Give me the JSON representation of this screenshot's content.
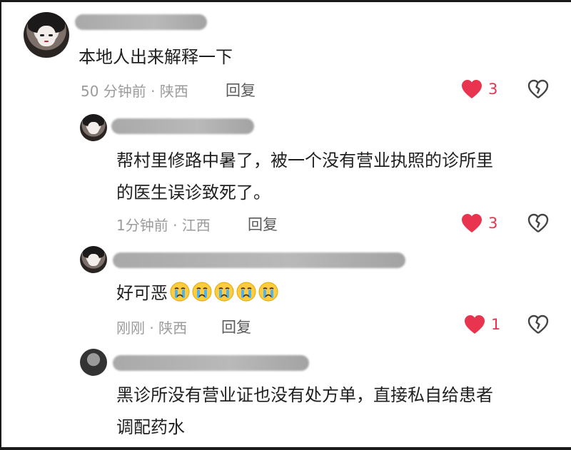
{
  "comments": [
    {
      "text": "本地人出来解释一下",
      "meta": "50 分钟前 · 陕西",
      "reply_label": "回复",
      "likes": "3"
    },
    {
      "text_line1": "帮村里修路中暑了，被一个没有营业执照的诊所里",
      "text_line2": "的医生误诊致死了。",
      "meta": "1分钟前 · 江西",
      "reply_label": "回复",
      "likes": "3"
    },
    {
      "text": "好可恶",
      "emoji": [
        "crying-face",
        "crying-face",
        "crying-face",
        "crying-face",
        "crying-face"
      ],
      "meta": "刚刚 · 陕西",
      "reply_label": "回复",
      "likes": "1"
    },
    {
      "text_line1": "黑诊所没有营业证也没有处方单，直接私自给患者",
      "text_line2": "调配药水"
    }
  ],
  "colors": {
    "like_red": "#e8344e",
    "meta_gray": "#9b9b9b"
  }
}
